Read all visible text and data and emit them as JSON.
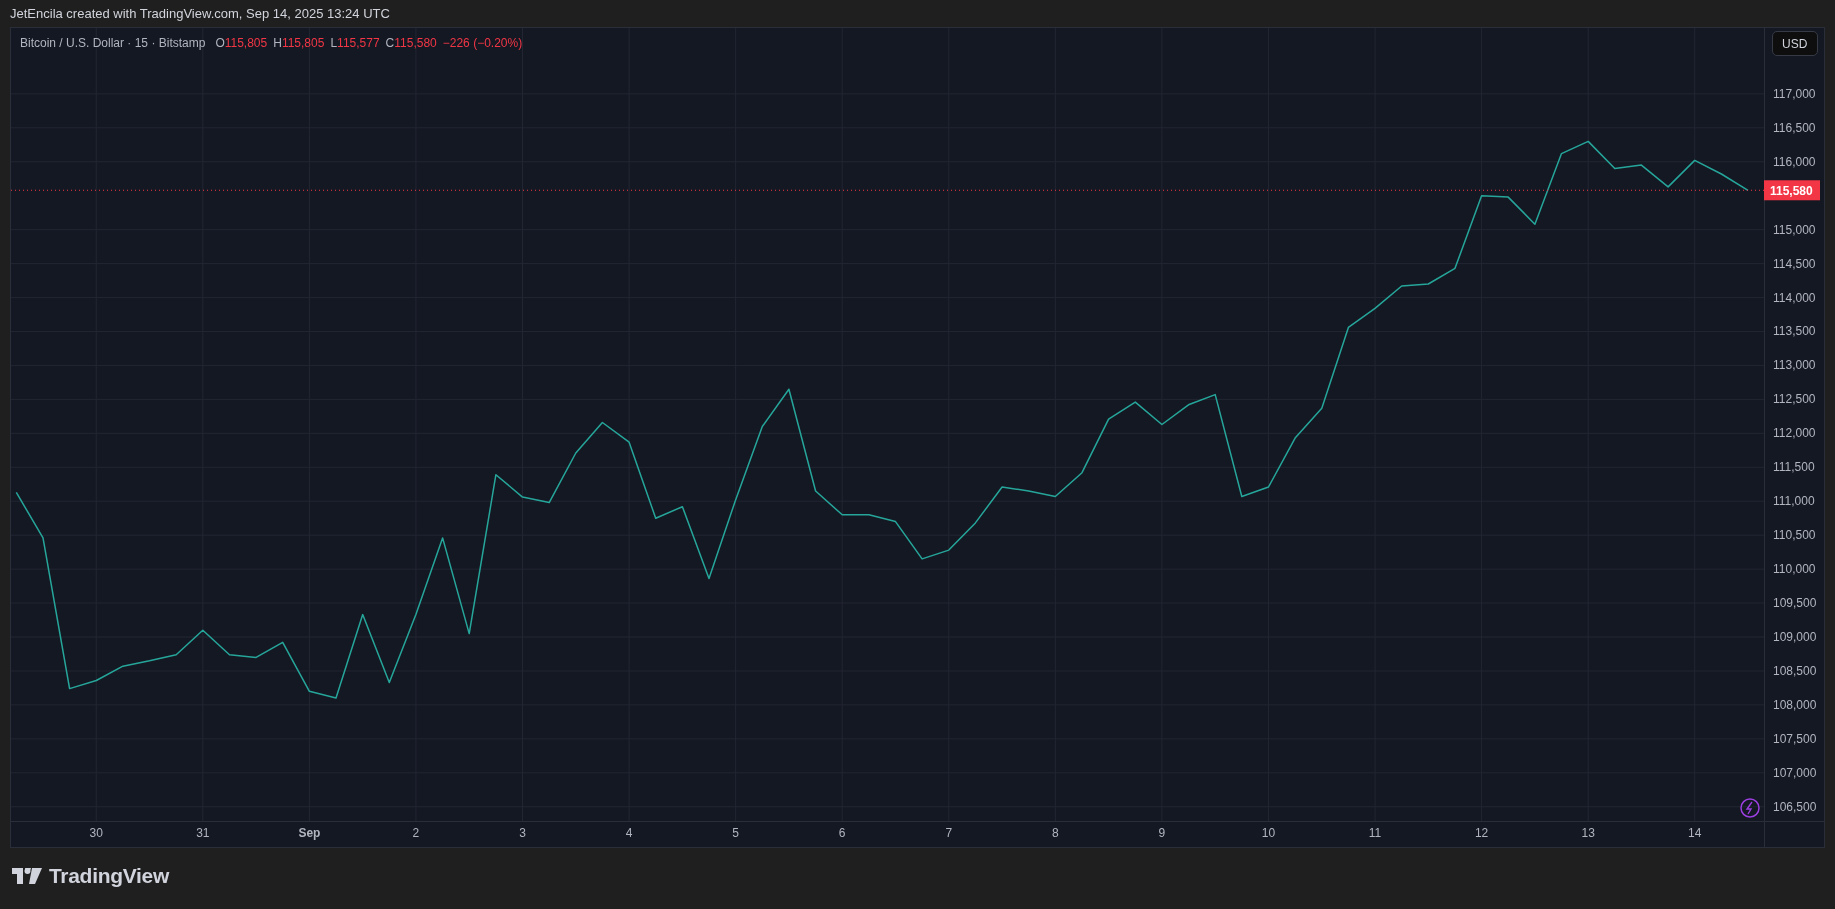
{
  "caption": "JetEncila created with TradingView.com, Sep 14, 2025 13:24 UTC",
  "legend": {
    "symbol": "Bitcoin / U.S. Dollar · 15 · Bitstamp",
    "values": [
      {
        "label": "O",
        "value": "115,805"
      },
      {
        "label": "H",
        "value": "115,805"
      },
      {
        "label": "L",
        "value": "115,577"
      },
      {
        "label": "C",
        "value": "115,580"
      }
    ],
    "change": "−226 (−0.20%)"
  },
  "currency_button": "USD",
  "last_price": "115,580",
  "chart": {
    "chart_data": {
      "type": "line",
      "categories": [
        null,
        null,
        null,
        "30",
        null,
        null,
        null,
        "31",
        null,
        null,
        null,
        "Sep",
        null,
        null,
        null,
        "2",
        null,
        null,
        null,
        "3",
        null,
        null,
        null,
        "4",
        null,
        null,
        null,
        "5",
        null,
        null,
        null,
        "6",
        null,
        null,
        null,
        "7",
        null,
        null,
        null,
        "8",
        null,
        null,
        null,
        "9",
        null,
        null,
        null,
        "10",
        null,
        null,
        null,
        "11",
        null,
        null,
        null,
        "12",
        null,
        null,
        null,
        "13",
        null,
        null,
        null,
        "14",
        null,
        null
      ],
      "series": [
        {
          "color": "#26a69a",
          "values": [
            111130,
            110460,
            108240,
            108360,
            108570,
            108650,
            108740,
            109100,
            108740,
            108700,
            108920,
            108200,
            108100,
            109330,
            108330,
            109330,
            110460,
            109050,
            111390,
            111060,
            110980,
            111710,
            112160,
            111870,
            110750,
            110920,
            109860,
            111020,
            112100,
            112650,
            111150,
            110800,
            110800,
            110700,
            110150,
            110280,
            110680,
            111210,
            111150,
            111070,
            111420,
            112210,
            112460,
            112130,
            112420,
            112570,
            111070,
            111210,
            111930,
            112370,
            113560,
            113840,
            114170,
            114200,
            114430,
            115500,
            115480,
            115080,
            116120,
            116300,
            115900,
            115950,
            115630,
            116020,
            115820,
            115580
          ]
        }
      ],
      "ylim": [
        106290,
        117970
      ],
      "grid": true,
      "ref_lines": [
        {
          "axis": "y",
          "value": 115580,
          "color": "#f23645"
        }
      ],
      "yticks": [
        {
          "value": 106500,
          "label": "106,500"
        },
        {
          "value": 107000,
          "label": "107,000"
        },
        {
          "value": 107500,
          "label": "107,500"
        },
        {
          "value": 108000,
          "label": "108,000"
        },
        {
          "value": 108500,
          "label": "108,500"
        },
        {
          "value": 109000,
          "label": "109,000"
        },
        {
          "value": 109500,
          "label": "109,500"
        },
        {
          "value": 110000,
          "label": "110,000"
        },
        {
          "value": 110500,
          "label": "110,500"
        },
        {
          "value": 111000,
          "label": "111,000"
        },
        {
          "value": 111500,
          "label": "111,500"
        },
        {
          "value": 112000,
          "label": "112,000"
        },
        {
          "value": 112500,
          "label": "112,500"
        },
        {
          "value": 113000,
          "label": "113,000"
        },
        {
          "value": 113500,
          "label": "113,500"
        },
        {
          "value": 114000,
          "label": "114,000"
        },
        {
          "value": 114500,
          "label": "114,500"
        },
        {
          "value": 115000,
          "label": "115,000"
        },
        {
          "value": 116000,
          "label": "116,000"
        },
        {
          "value": 116500,
          "label": "116,500"
        },
        {
          "value": 117000,
          "label": "117,000"
        }
      ]
    }
  },
  "brand": "TradingView"
}
